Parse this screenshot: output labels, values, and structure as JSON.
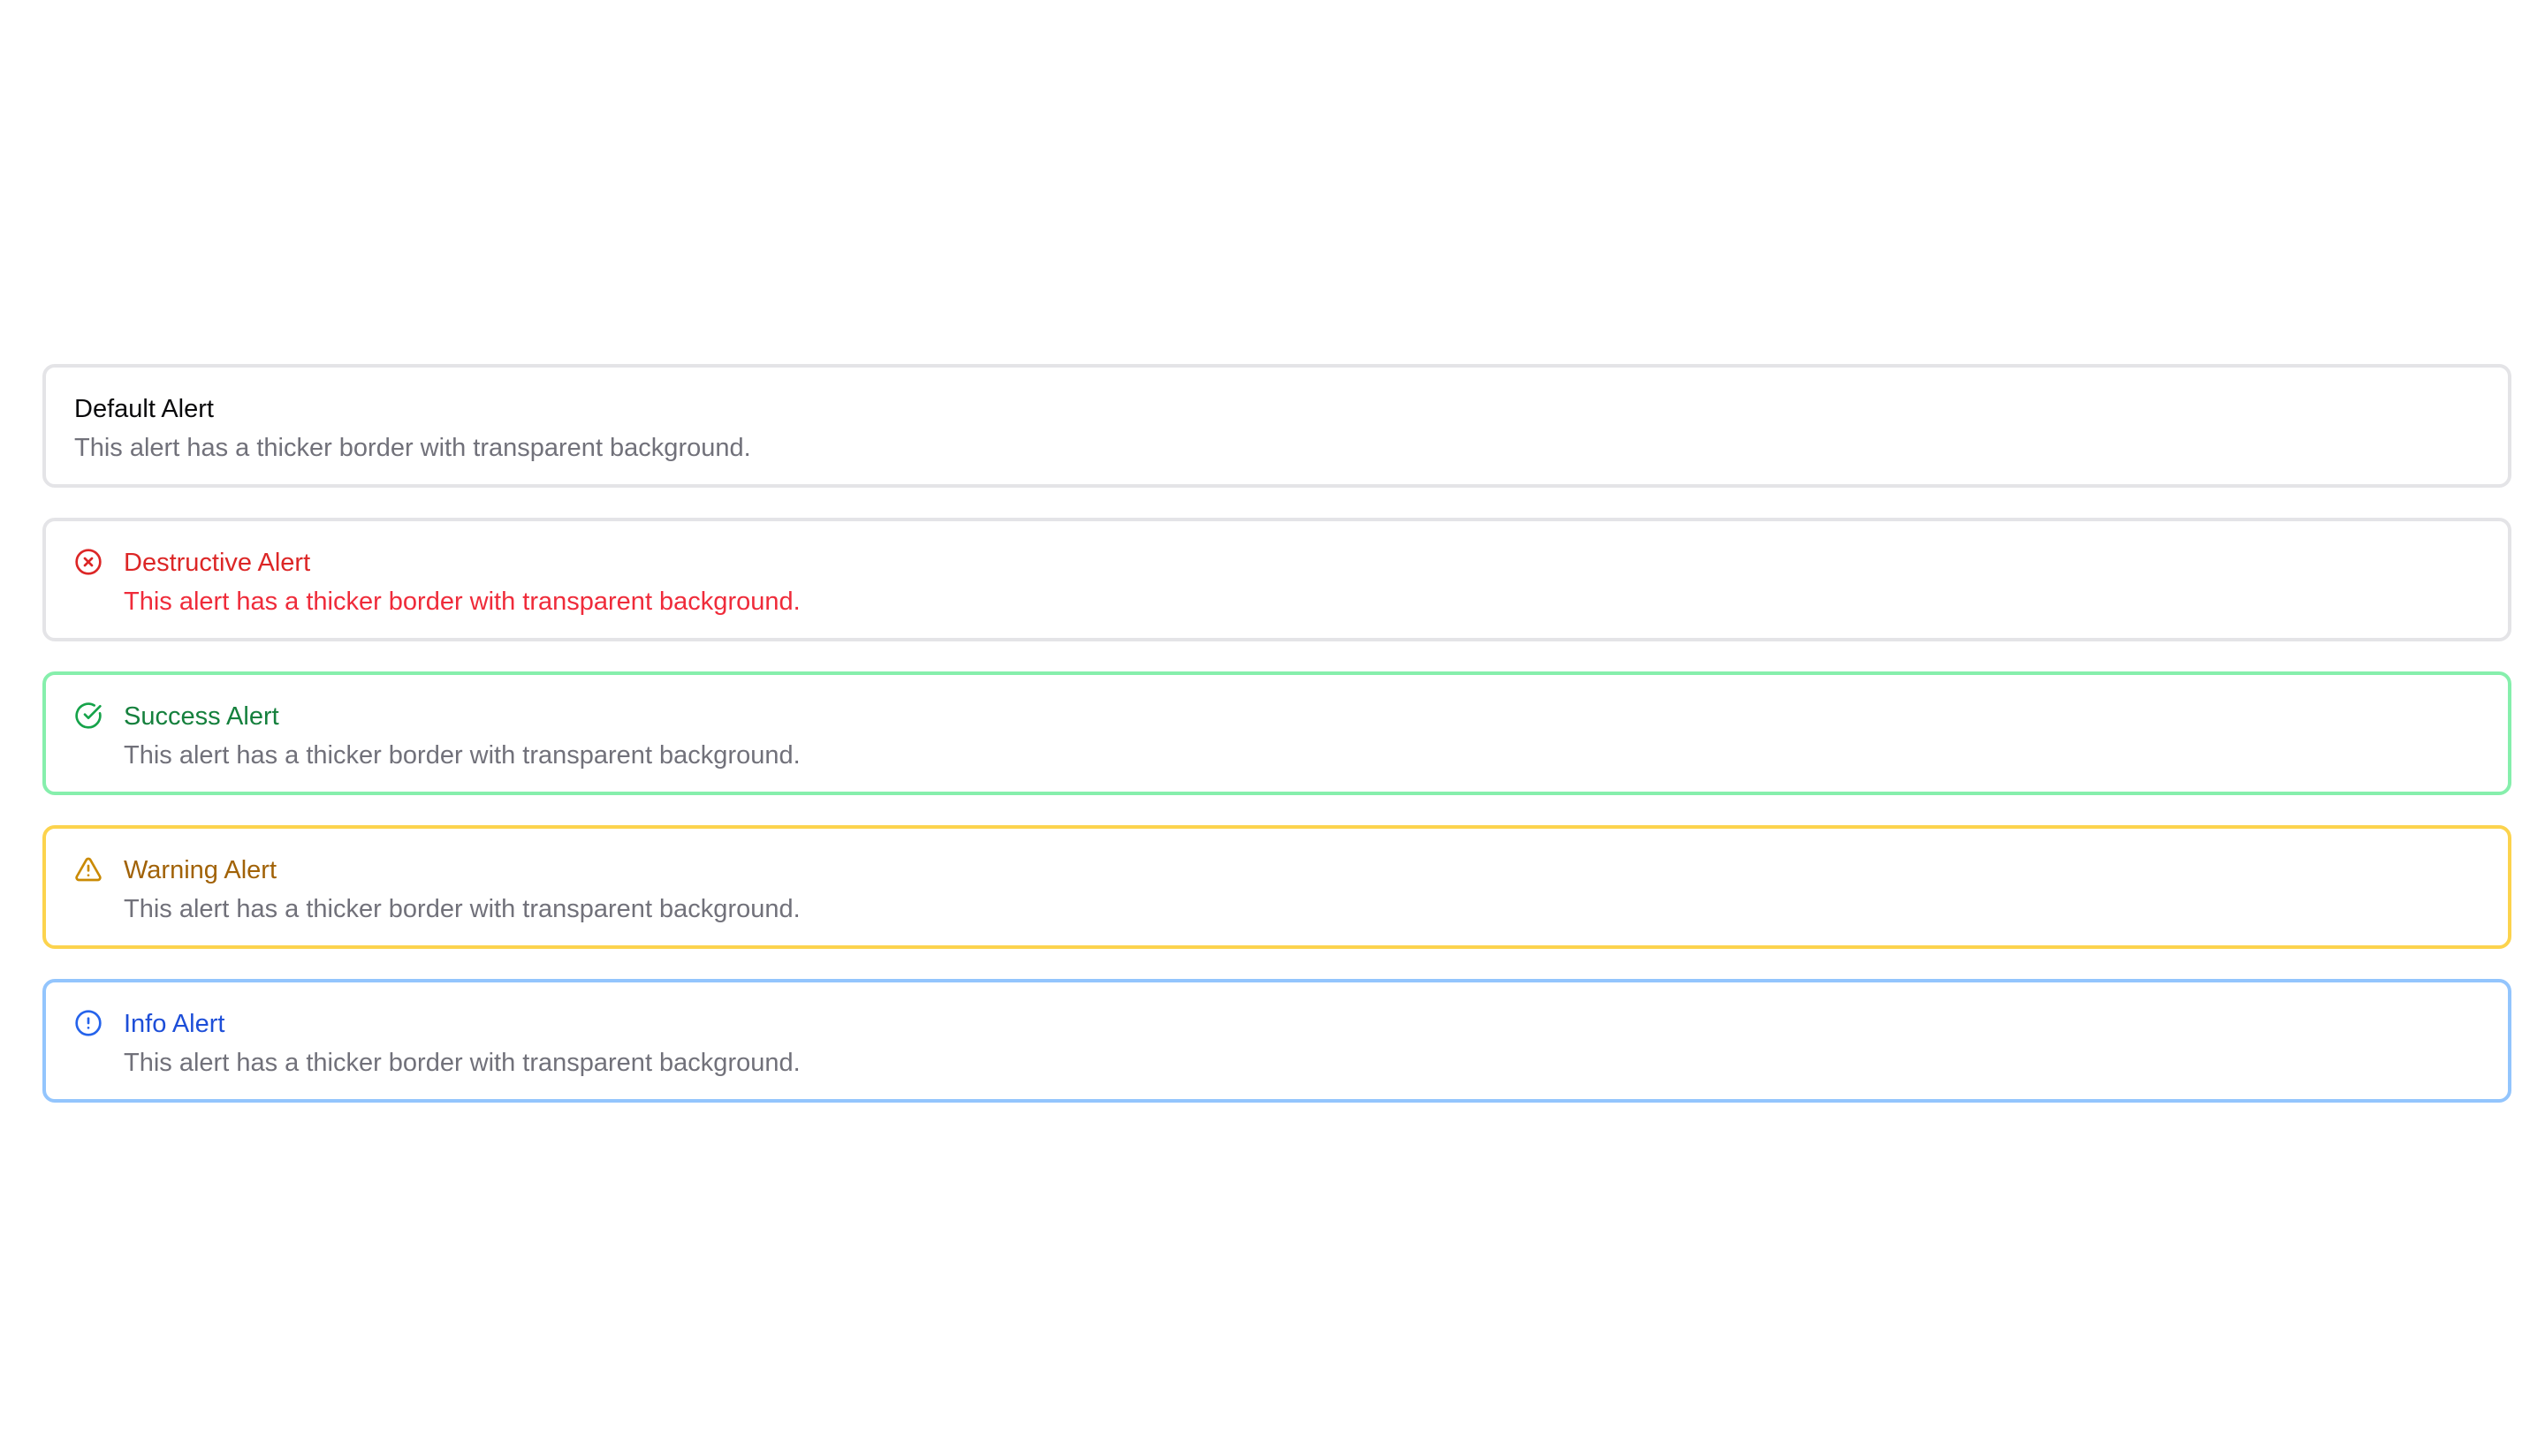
{
  "alerts": [
    {
      "variant": "default",
      "title": "Default Alert",
      "description": "This alert has a thicker border with transparent background.",
      "icon": null
    },
    {
      "variant": "destructive",
      "title": "Destructive Alert",
      "description": "This alert has a thicker border with transparent background.",
      "icon": "x-circle-icon",
      "color": "#dc2626"
    },
    {
      "variant": "success",
      "title": "Success Alert",
      "description": "This alert has a thicker border with transparent background.",
      "icon": "check-circle-icon",
      "color": "#16a34a",
      "border_color": "#86efac"
    },
    {
      "variant": "warning",
      "title": "Warning Alert",
      "description": "This alert has a thicker border with transparent background.",
      "icon": "triangle-alert-icon",
      "color": "#ca8a04",
      "border_color": "#fcd34d"
    },
    {
      "variant": "info",
      "title": "Info Alert",
      "description": "This alert has a thicker border with transparent background.",
      "icon": "info-circle-icon",
      "color": "#2563eb",
      "border_color": "#93c5fd"
    }
  ]
}
